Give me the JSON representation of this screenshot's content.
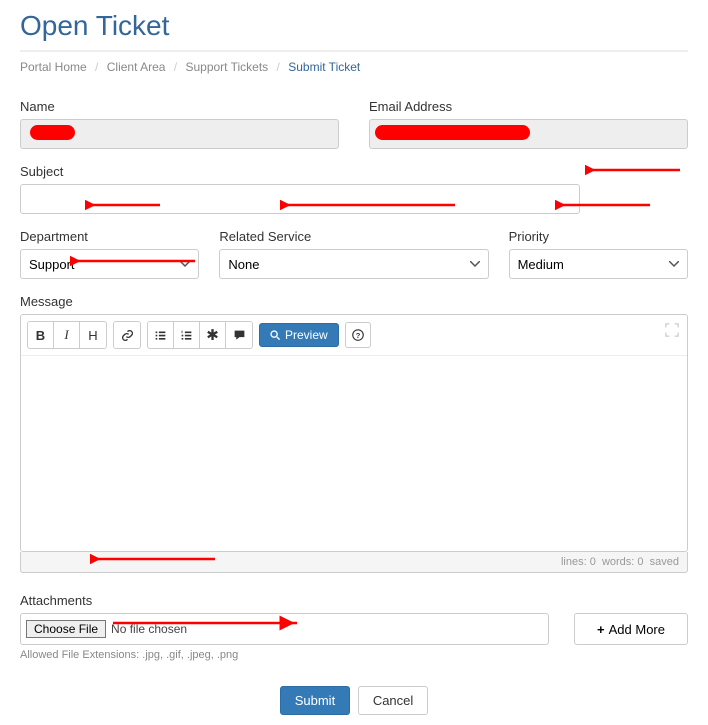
{
  "title": "Open Ticket",
  "breadcrumb": {
    "items": [
      "Portal Home",
      "Client Area",
      "Support Tickets"
    ],
    "current": "Submit Ticket"
  },
  "labels": {
    "name": "Name",
    "email": "Email Address",
    "subject": "Subject",
    "department": "Department",
    "related_service": "Related Service",
    "priority": "Priority",
    "message": "Message",
    "attachments": "Attachments"
  },
  "values": {
    "name": "",
    "email": "",
    "subject": "",
    "department": "Support",
    "related_service": "None",
    "priority": "Medium",
    "message": ""
  },
  "toolbar": {
    "bold": "B",
    "italic": "I",
    "heading": "H",
    "preview": "Preview"
  },
  "status": {
    "lines": "lines: 0",
    "words": "words: 0",
    "saved": "saved"
  },
  "attach": {
    "choose": "Choose File",
    "nofile": "No file chosen",
    "add_more": "Add More",
    "allowed": "Allowed File Extensions: .jpg, .gif, .jpeg, .png"
  },
  "actions": {
    "submit": "Submit",
    "cancel": "Cancel"
  }
}
